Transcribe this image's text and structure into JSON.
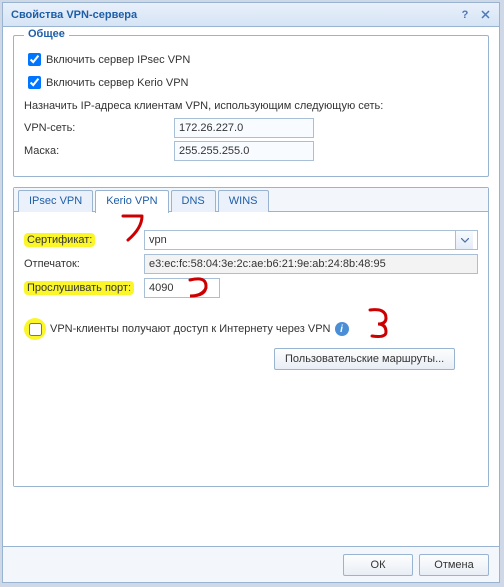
{
  "window_title": "Свойства VPN-сервера",
  "group": {
    "title": "Общее",
    "enable_ipsec": "Включить сервер IPsec VPN",
    "enable_kerio": "Включить сервер Kerio VPN",
    "assign_label": "Назначить IP-адреса клиентам VPN, использующим следующую сеть:",
    "net_label": "VPN-сеть:",
    "net_value": "172.26.227.0",
    "mask_label": "Маска:",
    "mask_value": "255.255.255.0"
  },
  "tabs": {
    "ipsec": "IPsec VPN",
    "kerio": "Kerio VPN",
    "dns": "DNS",
    "wins": "WINS"
  },
  "kerio_tab": {
    "cert_label": "Сертификат:",
    "cert_value": "vpn",
    "fp_label": "Отпечаток:",
    "fp_value": "e3:ec:fc:58:04:3e:2c:ae:b6:21:9e:ab:24:8b:48:95",
    "port_label": "Прослушивать порт:",
    "port_value": "4090",
    "vpn_clients_label": "VPN-клиенты получают доступ к Интернету через VPN",
    "routes_button": "Пользовательские маршруты..."
  },
  "footer": {
    "ok": "ОК",
    "cancel": "Отмена"
  }
}
